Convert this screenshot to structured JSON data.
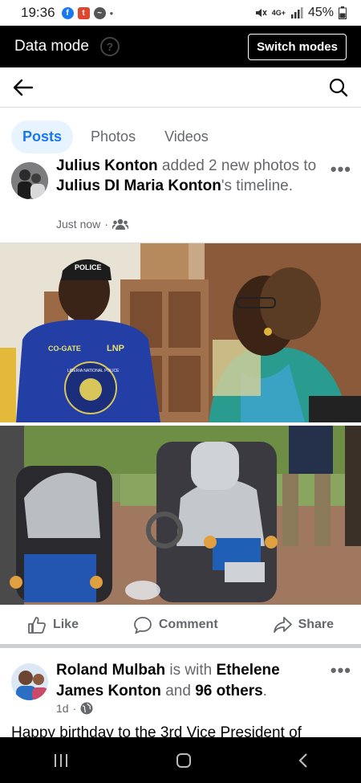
{
  "status_bar": {
    "time": "19:36",
    "network": "4G+",
    "battery": "45%"
  },
  "data_mode_bar": {
    "title": "Data mode",
    "help_symbol": "?",
    "switch_label": "Switch modes"
  },
  "tabs": [
    {
      "label": "Posts",
      "active": true
    },
    {
      "label": "Photos",
      "active": false
    },
    {
      "label": "Videos",
      "active": false
    }
  ],
  "post1": {
    "author": "Julius Konton",
    "action": " added 2 new photos to ",
    "target": "Julius DI Maria Konton",
    "suffix": "'s timeline.",
    "time": "Just now",
    "more": "•••"
  },
  "photo1": {
    "cap_text": "POLICE",
    "shirt_left": "CO-GATE",
    "shirt_right": "LNP",
    "badge": "LIBERIA NATIONAL POLICE"
  },
  "actions": {
    "like": "Like",
    "comment": "Comment",
    "share": "Share"
  },
  "post2": {
    "author": "Roland Mulbah",
    "with": " is with ",
    "tagged": "Ethelene James Konton",
    "and": " and ",
    "others": "96 others",
    "period": ".",
    "time": "1d",
    "more": "•••",
    "body": "Happy birthday to the 3rd Vice President of"
  }
}
